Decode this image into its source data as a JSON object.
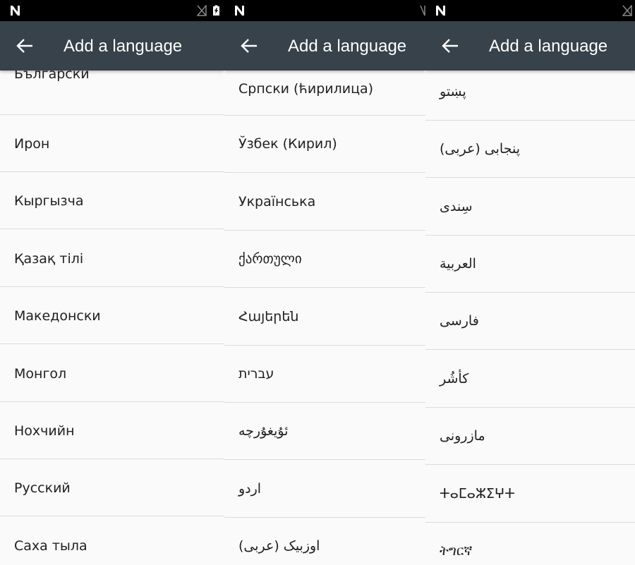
{
  "title": "Add a language",
  "panels": [
    {
      "items": [
        "Български",
        "Ирон",
        "Кыргызча",
        "Қазақ тілі",
        "Македонски",
        "Монгол",
        "Нохчийн",
        "Русский",
        "Саха тыла"
      ]
    },
    {
      "items": [
        "Српски (ћирилица)",
        "Ўзбек (Кирил)",
        "Українська",
        "ქართული",
        "Հայերեն",
        "עברית",
        "ئۇيغۇرچە",
        "اردو",
        "اوزبیک (عربی)"
      ]
    },
    {
      "items": [
        "پښتو",
        "پنجابی (عربی)",
        "سِندی",
        "العربية",
        "فارسی",
        "کأشُر",
        "مازرونی",
        "ⵜⴰⵎⴰⵣⵉⵖⵜ",
        "ትግርኛ"
      ]
    }
  ],
  "colors": {
    "toolbar": "#37424a",
    "statusbar": "#000000",
    "background": "#fafafa",
    "divider": "#dcdcdc"
  }
}
